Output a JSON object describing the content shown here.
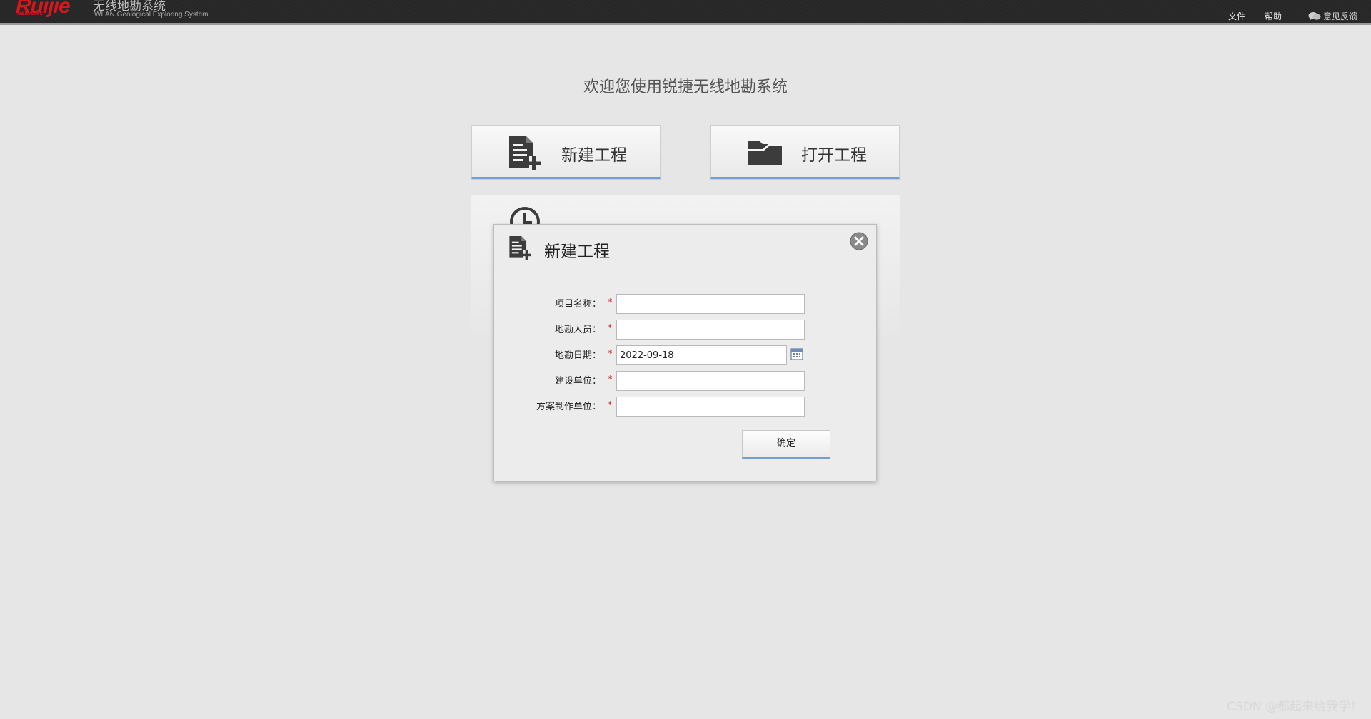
{
  "header": {
    "logo_text": "Ruijie",
    "logo_sub": "Networks",
    "system_title": "无线地勘系统",
    "system_subtitle": "WLAN Geological Exploring System",
    "menu": {
      "file": "文件",
      "help": "帮助",
      "feedback": "意见反馈"
    }
  },
  "main": {
    "welcome": "欢迎您使用锐捷无线地勘系统",
    "new_project_label": "新建工程",
    "open_project_label": "打开工程"
  },
  "dialog": {
    "title": "新建工程",
    "fields": [
      {
        "label": "项目名称：",
        "required_mark": "*",
        "value": ""
      },
      {
        "label": "地勘人员：",
        "required_mark": "*",
        "value": ""
      },
      {
        "label": "地勘日期：",
        "required_mark": "*",
        "value": "2022-09-18"
      },
      {
        "label": "建设单位：",
        "required_mark": "*",
        "value": ""
      },
      {
        "label": "方案制作单位：",
        "required_mark": "*",
        "value": ""
      }
    ],
    "confirm_label": "确定"
  },
  "watermark": "CSDN @都起来给我学！",
  "colors": {
    "brand_red": "#d8161b",
    "accent_blue": "#6f9fd8",
    "required_red": "#d9262c"
  }
}
